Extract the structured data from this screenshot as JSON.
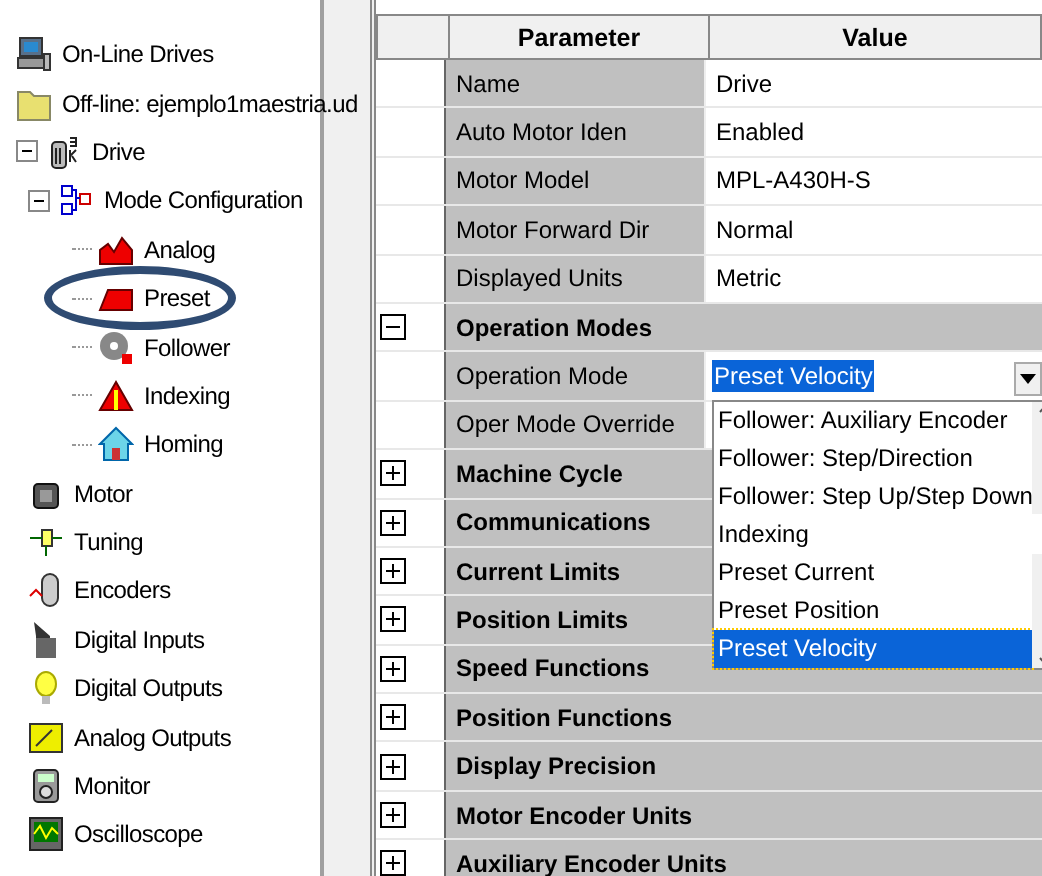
{
  "tree": [
    {
      "label": "On-Line Drives",
      "kind": "computer"
    },
    {
      "label": "Off-line: ejemplo1maestria.ud",
      "kind": "folder",
      "children": [
        {
          "label": "Drive",
          "kind": "drive",
          "expanded": true,
          "children": [
            {
              "label": "Mode Configuration",
              "kind": "modes",
              "expanded": true,
              "children": [
                {
                  "label": "Analog",
                  "kind": "analog"
                },
                {
                  "label": "Preset",
                  "kind": "preset",
                  "circled": true
                },
                {
                  "label": "Follower",
                  "kind": "follower"
                },
                {
                  "label": "Indexing",
                  "kind": "indexing"
                },
                {
                  "label": "Homing",
                  "kind": "homing"
                }
              ]
            },
            {
              "label": "Motor",
              "kind": "motor"
            },
            {
              "label": "Tuning",
              "kind": "tuning"
            },
            {
              "label": "Encoders",
              "kind": "encoders"
            },
            {
              "label": "Digital Inputs",
              "kind": "switch"
            },
            {
              "label": "Digital Outputs",
              "kind": "bulb"
            },
            {
              "label": "Analog Outputs",
              "kind": "meter"
            },
            {
              "label": "Monitor",
              "kind": "monitor"
            },
            {
              "label": "Oscilloscope",
              "kind": "scope"
            }
          ]
        }
      ]
    }
  ],
  "grid": {
    "columns": [
      "Parameter",
      "Value"
    ],
    "rows": [
      {
        "kind": "param",
        "name": "Name",
        "value": "Drive"
      },
      {
        "kind": "param",
        "name": "Auto Motor Iden",
        "value": "Enabled"
      },
      {
        "kind": "param",
        "name": "Motor Model",
        "value": "MPL-A430H-S"
      },
      {
        "kind": "param",
        "name": "Motor Forward Dir",
        "value": "Normal"
      },
      {
        "kind": "param",
        "name": "Displayed Units",
        "value": "Metric"
      },
      {
        "kind": "group",
        "name": "Operation Modes",
        "expanded": true
      },
      {
        "kind": "combo",
        "name": "Operation Mode",
        "value": "Preset Velocity",
        "options": [
          {
            "label": "Follower: Auxiliary Encoder",
            "selected": false
          },
          {
            "label": "Follower: Step/Direction",
            "selected": false
          },
          {
            "label": "Follower: Step Up/Step Down",
            "selected": false
          },
          {
            "label": "Indexing",
            "selected": false
          },
          {
            "label": "Preset Current",
            "selected": false
          },
          {
            "label": "Preset Position",
            "selected": false
          },
          {
            "label": "Preset Velocity",
            "selected": true
          }
        ]
      },
      {
        "kind": "param",
        "name": "Oper Mode Override"
      },
      {
        "kind": "group",
        "name": "Machine Cycle",
        "expanded": false
      },
      {
        "kind": "group",
        "name": "Communications",
        "expanded": false
      },
      {
        "kind": "group",
        "name": "Current Limits",
        "expanded": false
      },
      {
        "kind": "group",
        "name": "Position Limits",
        "expanded": false
      },
      {
        "kind": "group",
        "name": "Speed Functions",
        "expanded": false
      },
      {
        "kind": "group",
        "name": "Position Functions",
        "expanded": false
      },
      {
        "kind": "group",
        "name": "Display Precision",
        "expanded": false
      },
      {
        "kind": "group",
        "name": "Motor Encoder Units",
        "expanded": false
      },
      {
        "kind": "group",
        "name": "Auxiliary Encoder Units",
        "expanded": false
      }
    ]
  }
}
